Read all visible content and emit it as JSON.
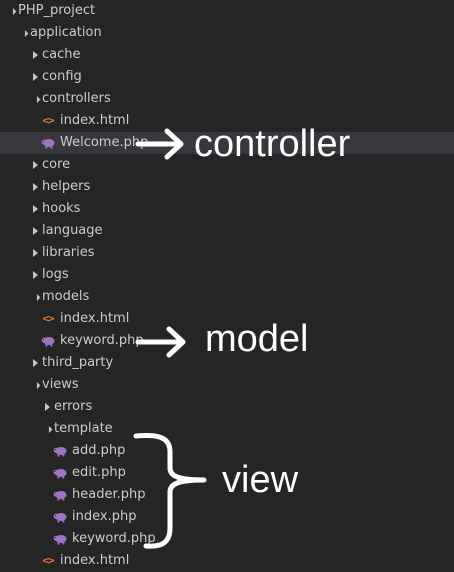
{
  "explorer": {
    "items": [
      {
        "label": "PHP_project",
        "kind": "folder",
        "state": "open",
        "depth": 0
      },
      {
        "label": "application",
        "kind": "folder",
        "state": "open",
        "depth": 1
      },
      {
        "label": "cache",
        "kind": "folder",
        "state": "closed",
        "depth": 2
      },
      {
        "label": "config",
        "kind": "folder",
        "state": "closed",
        "depth": 2
      },
      {
        "label": "controllers",
        "kind": "folder",
        "state": "open",
        "depth": 2
      },
      {
        "label": "index.html",
        "kind": "html",
        "depth": 3
      },
      {
        "label": "Welcome.php",
        "kind": "php",
        "depth": 3,
        "selected": true
      },
      {
        "label": "core",
        "kind": "folder",
        "state": "closed",
        "depth": 2
      },
      {
        "label": "helpers",
        "kind": "folder",
        "state": "closed",
        "depth": 2
      },
      {
        "label": "hooks",
        "kind": "folder",
        "state": "closed",
        "depth": 2
      },
      {
        "label": "language",
        "kind": "folder",
        "state": "closed",
        "depth": 2
      },
      {
        "label": "libraries",
        "kind": "folder",
        "state": "closed",
        "depth": 2
      },
      {
        "label": "logs",
        "kind": "folder",
        "state": "closed",
        "depth": 2
      },
      {
        "label": "models",
        "kind": "folder",
        "state": "open",
        "depth": 2
      },
      {
        "label": "index.html",
        "kind": "html",
        "depth": 3
      },
      {
        "label": "keyword.php",
        "kind": "php",
        "depth": 3
      },
      {
        "label": "third_party",
        "kind": "folder",
        "state": "closed",
        "depth": 2
      },
      {
        "label": "views",
        "kind": "folder",
        "state": "open",
        "depth": 2
      },
      {
        "label": "errors",
        "kind": "folder",
        "state": "closed",
        "depth": 3
      },
      {
        "label": "template",
        "kind": "folder",
        "state": "open",
        "depth": 3
      },
      {
        "label": "add.php",
        "kind": "php",
        "depth": 4
      },
      {
        "label": "edit.php",
        "kind": "php",
        "depth": 4
      },
      {
        "label": "header.php",
        "kind": "php",
        "depth": 4
      },
      {
        "label": "index.php",
        "kind": "php",
        "depth": 4
      },
      {
        "label": "keyword.php",
        "kind": "php",
        "depth": 4
      },
      {
        "label": "index.html",
        "kind": "html",
        "depth": 3
      }
    ]
  },
  "annotations": {
    "controller": "controller",
    "model": "model",
    "view": "view"
  },
  "colors": {
    "background": "#252526",
    "selection": "#37373d",
    "text": "#cccccc",
    "php_icon": "#a074c4",
    "html_icon": "#e37933",
    "annotation": "#ffffff"
  },
  "icons": {
    "folder_open": "chevron-down-icon",
    "folder_closed": "chevron-right-icon",
    "php": "php-elephant-icon",
    "html": "html-brackets-icon"
  }
}
